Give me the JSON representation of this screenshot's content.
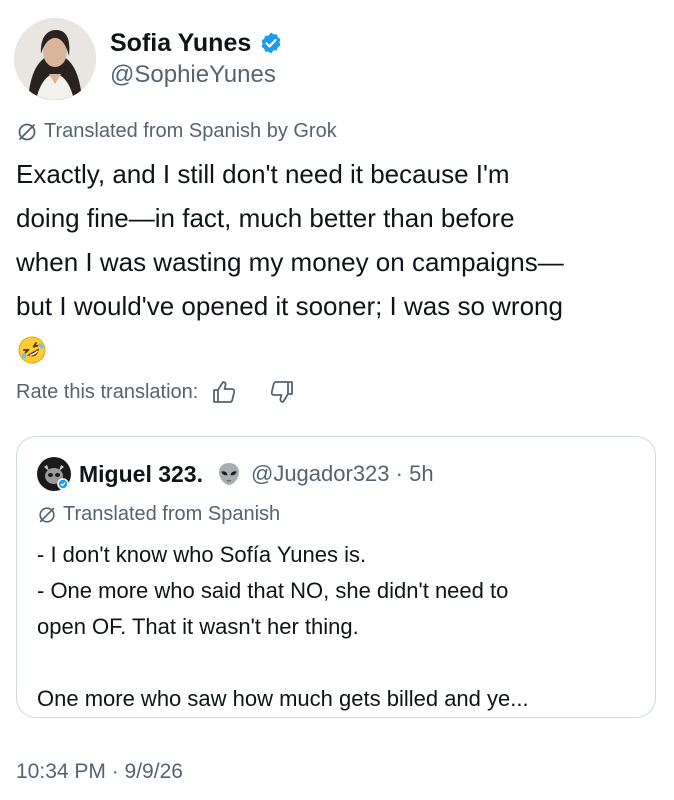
{
  "author": {
    "display_name": "Sofia Yunes",
    "handle": "@SophieYunes",
    "verified_color": "#1d9bf0"
  },
  "translation_note": "Translated from Spanish by Grok",
  "post_lines": [
    "Exactly, and I still don't need it because I'm",
    "doing fine—in fact, much better than before",
    "when I was wasting my money on campaigns—",
    "but I would've opened it sooner; I was so wrong"
  ],
  "rate_label": "Rate this translation:",
  "quoted": {
    "display_name": "Miguel 323.",
    "handle_time": "@Jugador323 · 5h",
    "translation_note": "Translated from Spanish",
    "lines": [
      "- I don't know who Sofía Yunes is.",
      "- One more who said that NO, she didn't need to",
      "open OF. That it wasn't her thing.",
      "",
      "One more who saw how much gets billed and ye..."
    ]
  },
  "timestamp": "10:34 PM · 9/9/26",
  "colors": {
    "text": "#0f1419",
    "secondary": "#536471",
    "border": "#cfd9de",
    "accent": "#1d9bf0"
  }
}
